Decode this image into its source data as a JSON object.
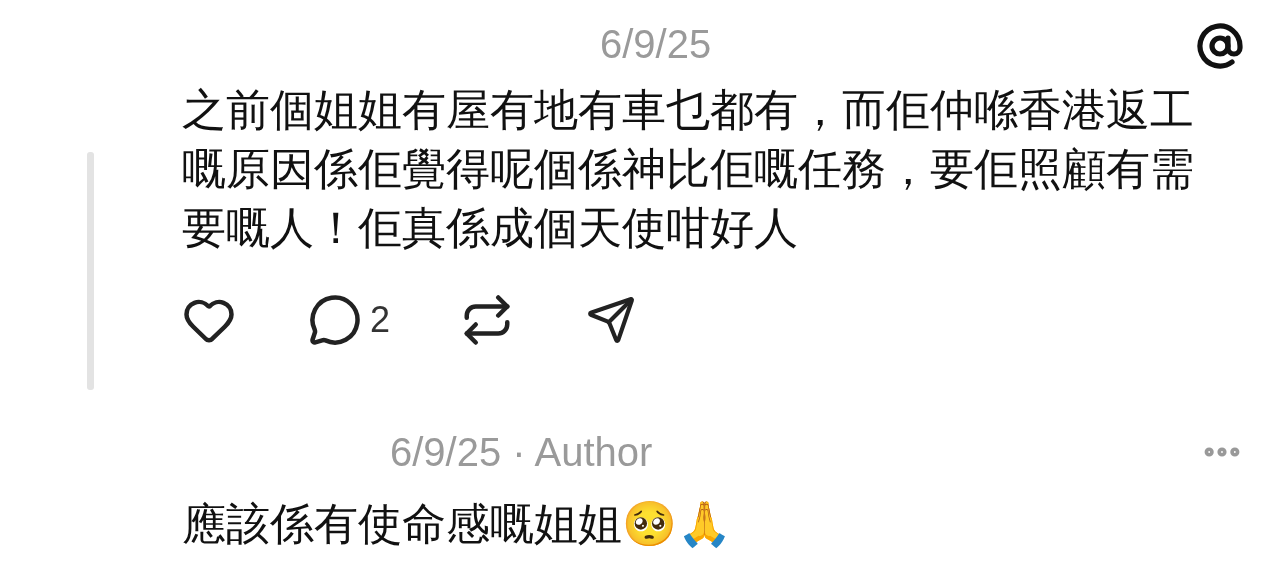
{
  "post": {
    "date": "6/9/25",
    "text": "之前個姐姐有屋有地有車乜都有，而佢仲喺香港返工嘅原因係佢覺得呢個係神比佢嘅任務，要佢照顧有需要嘅人！佢真係成個天使咁好人",
    "comment_count": "2"
  },
  "reply": {
    "meta": "6/9/25 · Author",
    "text": "應該係有使命感嘅姐姐🥺🙏"
  }
}
